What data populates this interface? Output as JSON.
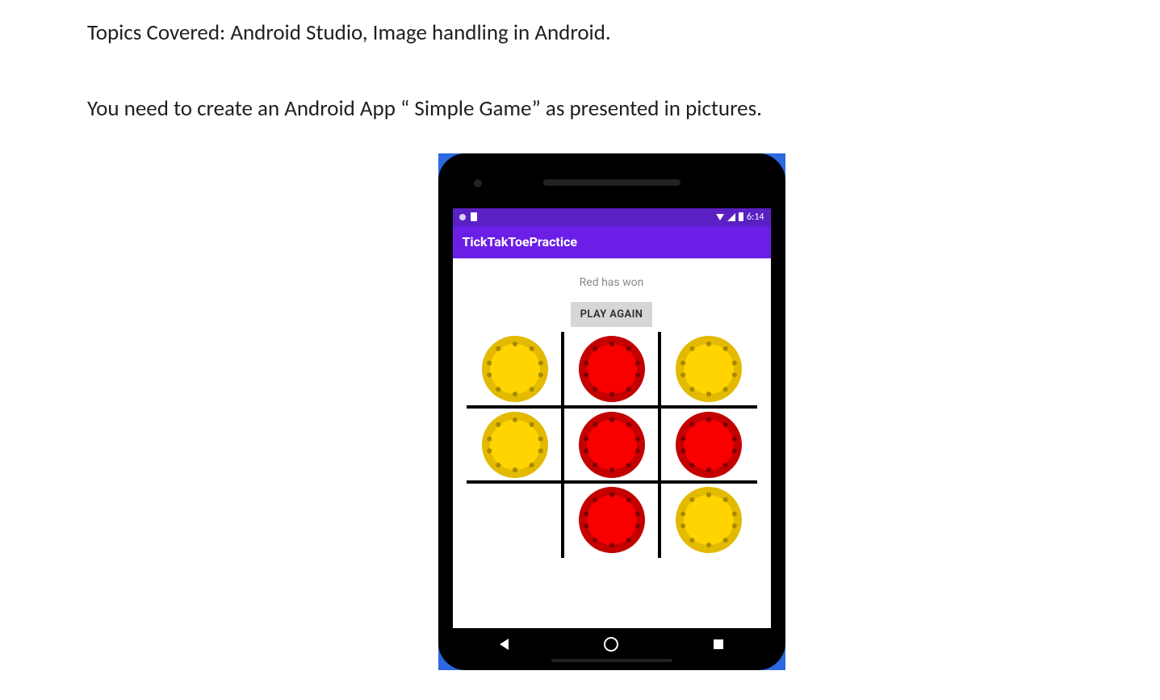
{
  "doc": {
    "line1": "Topics Covered: Android Studio, Image handling in Android.",
    "line2": "You need to create an Android App “ Simple Game” as presented in pictures."
  },
  "phone": {
    "status": {
      "time": "6:14"
    },
    "appbar": {
      "title": "TickTakToePractice"
    },
    "game": {
      "status_text": "Red has won",
      "play_again_label": "PLAY AGAIN",
      "board": [
        [
          "yellow",
          "red",
          "yellow"
        ],
        [
          "yellow",
          "red",
          "red"
        ],
        [
          "",
          "red",
          "yellow"
        ]
      ],
      "colors": {
        "yellow": "#ffd400",
        "red": "#f80000"
      }
    }
  }
}
